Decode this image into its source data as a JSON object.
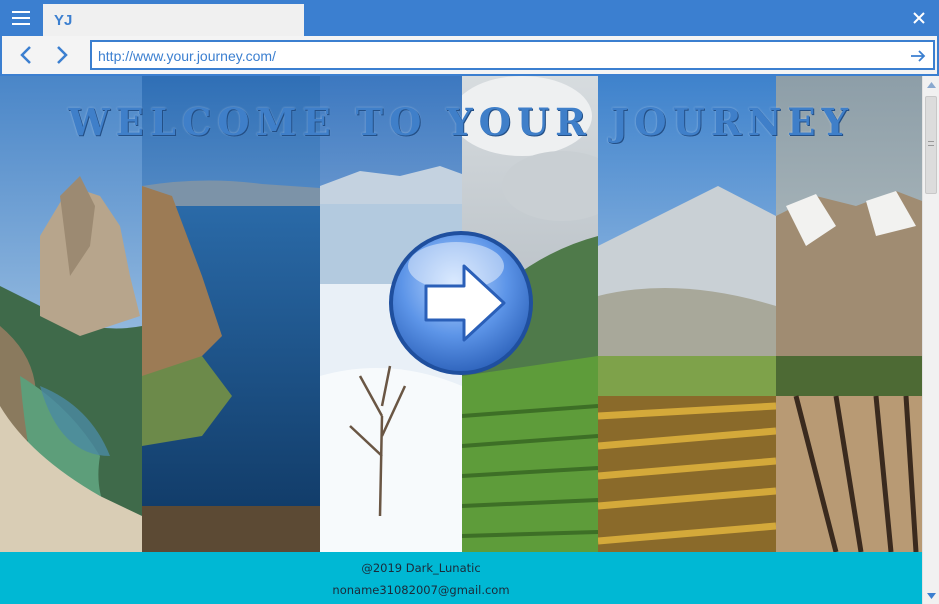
{
  "browser": {
    "tab_title": "YJ",
    "url": "http://www.your.journey.com/",
    "accent_color": "#3b7fd0"
  },
  "icons": {
    "menu": "hamburger-icon",
    "close": "close-icon",
    "back": "chevron-left-icon",
    "forward": "chevron-right-icon",
    "go": "arrow-right-icon",
    "enter": "enter-arrow-icon"
  },
  "page": {
    "hero_title": "WELCOME TO YOUR JOURNEY",
    "title_color": "#3f7fc9",
    "footer": {
      "copyright": "@2019 Dark_Lunatic",
      "email": "noname31082007@gmail.com",
      "background": "#00b8d4"
    }
  }
}
